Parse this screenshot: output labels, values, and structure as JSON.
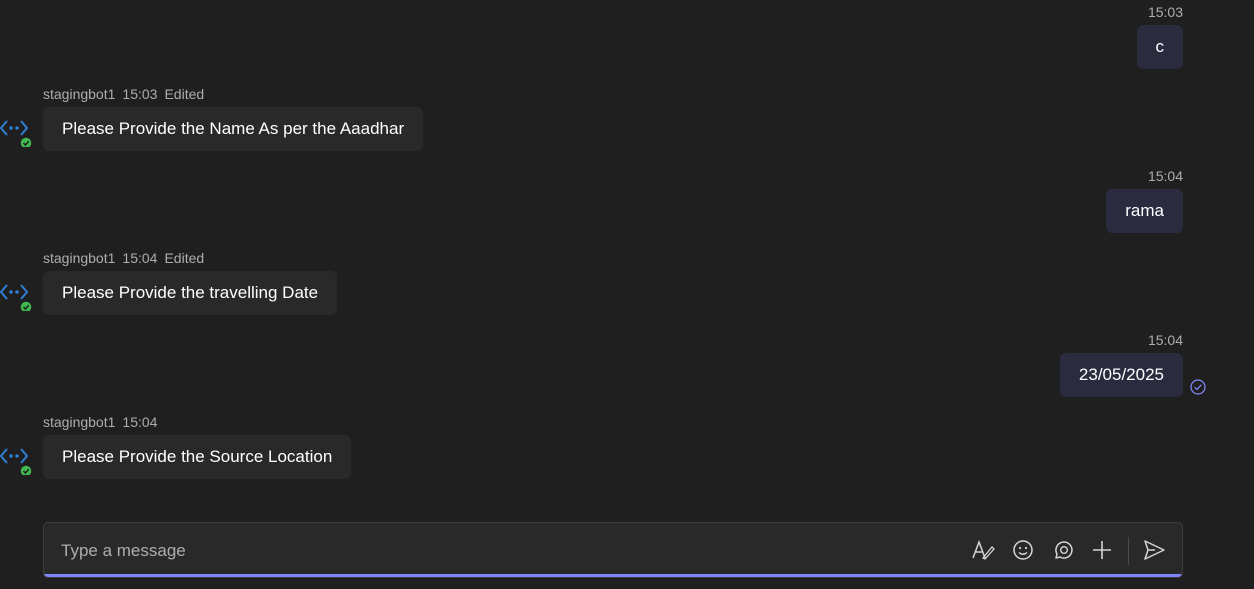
{
  "messages": [
    {
      "direction": "out",
      "time": "15:03",
      "text": "c"
    },
    {
      "direction": "in",
      "sender": "stagingbot1",
      "time": "15:03",
      "status": "Edited",
      "text": "Please Provide the Name As per the Aaadhar"
    },
    {
      "direction": "out",
      "time": "15:04",
      "text": "rama"
    },
    {
      "direction": "in",
      "sender": "stagingbot1",
      "time": "15:04",
      "status": "Edited",
      "text": "Please Provide the travelling Date"
    },
    {
      "direction": "out",
      "time": "15:04",
      "text": "23/05/2025",
      "read_icon": "read-receipt-icon"
    },
    {
      "direction": "in",
      "sender": "stagingbot1",
      "time": "15:04",
      "text": "Please Provide the Source Location"
    }
  ],
  "compose": {
    "placeholder": "Type a message",
    "value": "",
    "tools": [
      "format-icon",
      "emoji-icon",
      "loop-icon",
      "add-icon",
      "send-icon"
    ]
  },
  "colors": {
    "background": "#1f1f1f",
    "outgoing_bubble": "#2b2b40",
    "incoming_bubble": "#292929",
    "accent": "#7f85f5",
    "bot_icon": "#2f7fd6",
    "online_badge": "#3fb950",
    "muted_text": "#adadad"
  }
}
